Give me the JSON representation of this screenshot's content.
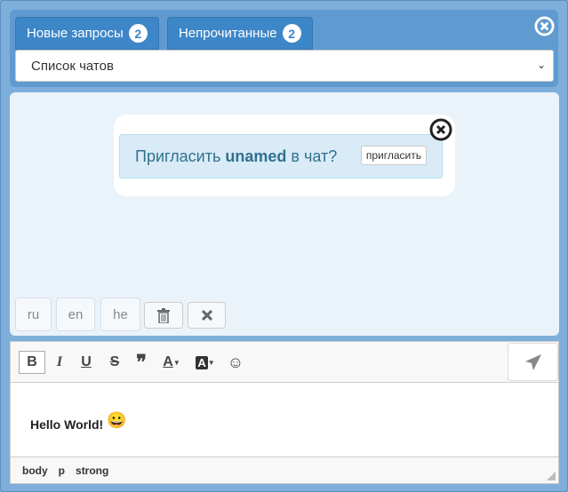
{
  "tabs": [
    {
      "label": "Новые запросы",
      "count": "2"
    },
    {
      "label": "Непрочитанные",
      "count": "2"
    }
  ],
  "chat_select": {
    "value": "Список чатов"
  },
  "invite": {
    "prefix": "Пригласить",
    "user": "unamed",
    "suffix": "в чат?",
    "button": "пригласить"
  },
  "languages": [
    "ru",
    "en",
    "he"
  ],
  "editor": {
    "content": "Hello World!",
    "emoji": "😀",
    "path": [
      "body",
      "p",
      "strong"
    ]
  },
  "toolbar": {
    "bold": "B",
    "italic": "I",
    "underline": "U",
    "strike": "S",
    "quote": "❞",
    "font_color": "A",
    "bg_color": "A"
  }
}
